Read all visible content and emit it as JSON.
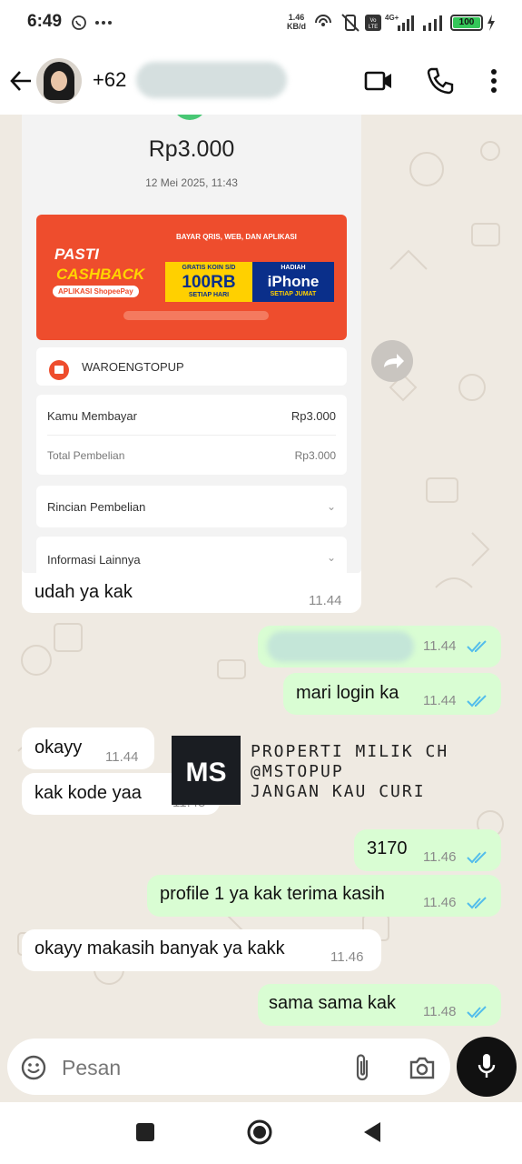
{
  "status_bar": {
    "time": "6:49",
    "net_speed": "1.46",
    "net_unit": "KB/d",
    "battery": "100"
  },
  "header": {
    "contact_prefix": "+62"
  },
  "receipt": {
    "amount": "Rp3.000",
    "datetime": "12 Mei 2025, 11:43",
    "banner": {
      "pasti": "PASTI",
      "cashback": "CASHBACK",
      "aplikasi": "APLIKASI ShopeePay",
      "bayar": "BAYAR QRIS, WEB, DAN APLIKASI",
      "gratis": "GRATIS KOIN S/D",
      "gratis_value": "100RB",
      "gratis_sub": "SETIAP HARI",
      "hadiah": "HADIAH",
      "hadiah_value": "iPhone",
      "hadiah_sub": "SETIAP JUMAT"
    },
    "store": "WAROENGTOPUP",
    "paid_label": "Kamu Membayar",
    "paid_value": "Rp3.000",
    "total_label": "Total Pembelian",
    "total_value": "Rp3.000",
    "detail_label": "Rincian Pembelian",
    "info_label": "Informasi Lainnya"
  },
  "messages": {
    "m1": {
      "text": "udah ya kak",
      "time": "11.44"
    },
    "m2": {
      "time": "11.44"
    },
    "m3": {
      "text": "mari login ka",
      "time": "11.44"
    },
    "m4": {
      "text": "okayy",
      "time": "11.44"
    },
    "m5": {
      "text": "kak kode yaa",
      "time": "11.45"
    },
    "m6": {
      "text": "3170",
      "time": "11.46"
    },
    "m7": {
      "text": "profile 1 ya kak terima kasih",
      "time": "11.46"
    },
    "m8": {
      "text": "okayy makasih banyak ya kakk",
      "time": "11.46"
    },
    "m9": {
      "text": "sama sama kak",
      "time": "11.48"
    }
  },
  "watermark": {
    "logo": "MS",
    "line1": "PROPERTI MILIK CH",
    "line2": "@MSTOPUP",
    "line3": "JANGAN KAU CURI"
  },
  "input": {
    "placeholder": "Pesan"
  },
  "colors": {
    "outgoing_bubble": "#d9fdd3",
    "incoming_bubble": "#ffffff",
    "read_tick": "#53bdeb",
    "shopee_orange": "#ee4d2d"
  },
  "icons": [
    "back-arrow-icon",
    "video-call-icon",
    "phone-icon",
    "more-vert-icon",
    "forward-icon",
    "read-ticks-icon",
    "emoji-icon",
    "attach-icon",
    "camera-icon",
    "mic-icon",
    "nav-recents-icon",
    "nav-home-icon",
    "nav-back-icon"
  ]
}
